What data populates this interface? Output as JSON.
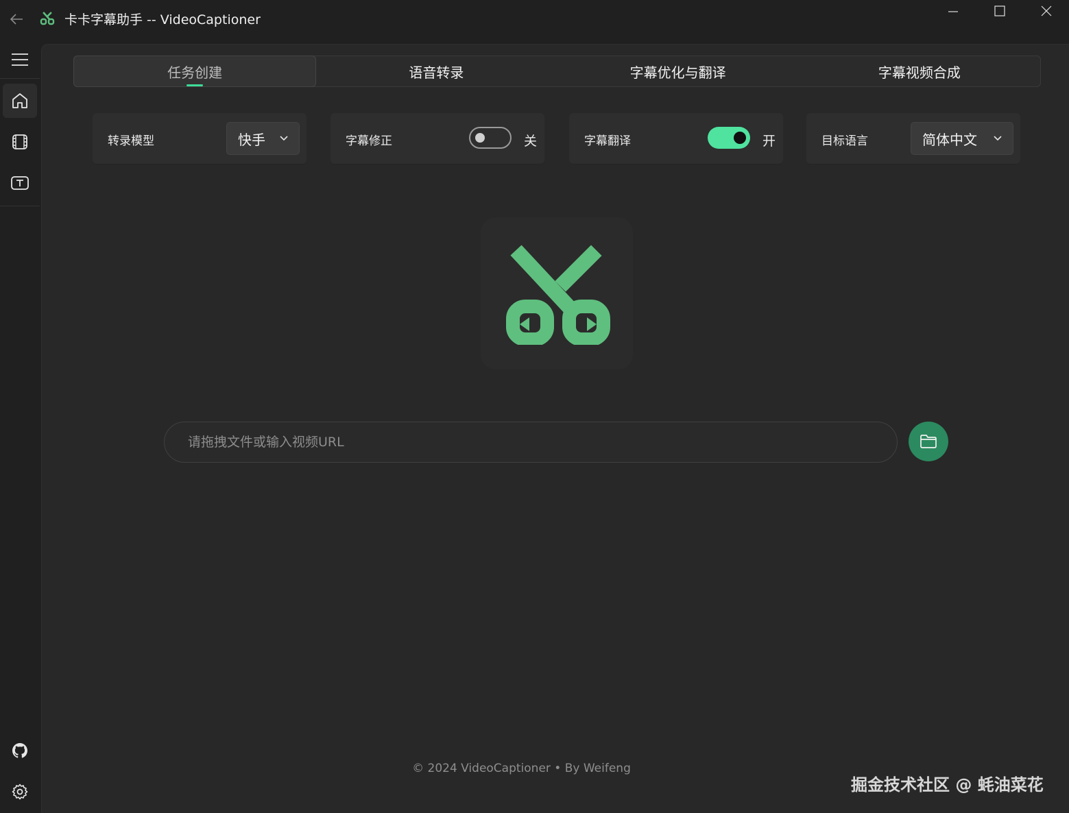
{
  "window": {
    "title": "卡卡字幕助手 -- VideoCaptioner"
  },
  "tabs": [
    {
      "label": "任务创建",
      "active": true
    },
    {
      "label": "语音转录",
      "active": false
    },
    {
      "label": "字幕优化与翻译",
      "active": false
    },
    {
      "label": "字幕视频合成",
      "active": false
    }
  ],
  "settings": {
    "model": {
      "label": "转录模型",
      "value": "快手"
    },
    "correction": {
      "label": "字幕修正",
      "enabled": false,
      "state_text": "关"
    },
    "translation": {
      "label": "字幕翻译",
      "enabled": true,
      "state_text": "开"
    },
    "target_language": {
      "label": "目标语言",
      "value": "简体中文"
    }
  },
  "input": {
    "placeholder": "请拖拽文件或输入视频URL",
    "value": ""
  },
  "footer": {
    "text": "© 2024 VideoCaptioner • By Weifeng"
  },
  "watermark": {
    "text": "掘金技术社区 @ 蚝油菜花"
  },
  "icons": {
    "app": "scissors-icon",
    "back": "arrow-left-icon",
    "menu": "hamburger-icon",
    "home": "home-icon",
    "video": "film-icon",
    "subtitle": "text-box-icon",
    "github": "github-icon",
    "settings": "gear-icon",
    "folder": "folder-icon"
  },
  "colors": {
    "accent": "#3ddc97",
    "toggle_on": "#4fe39f",
    "logo": "#5fbf7f",
    "folder_button": "#2b8a5f"
  }
}
